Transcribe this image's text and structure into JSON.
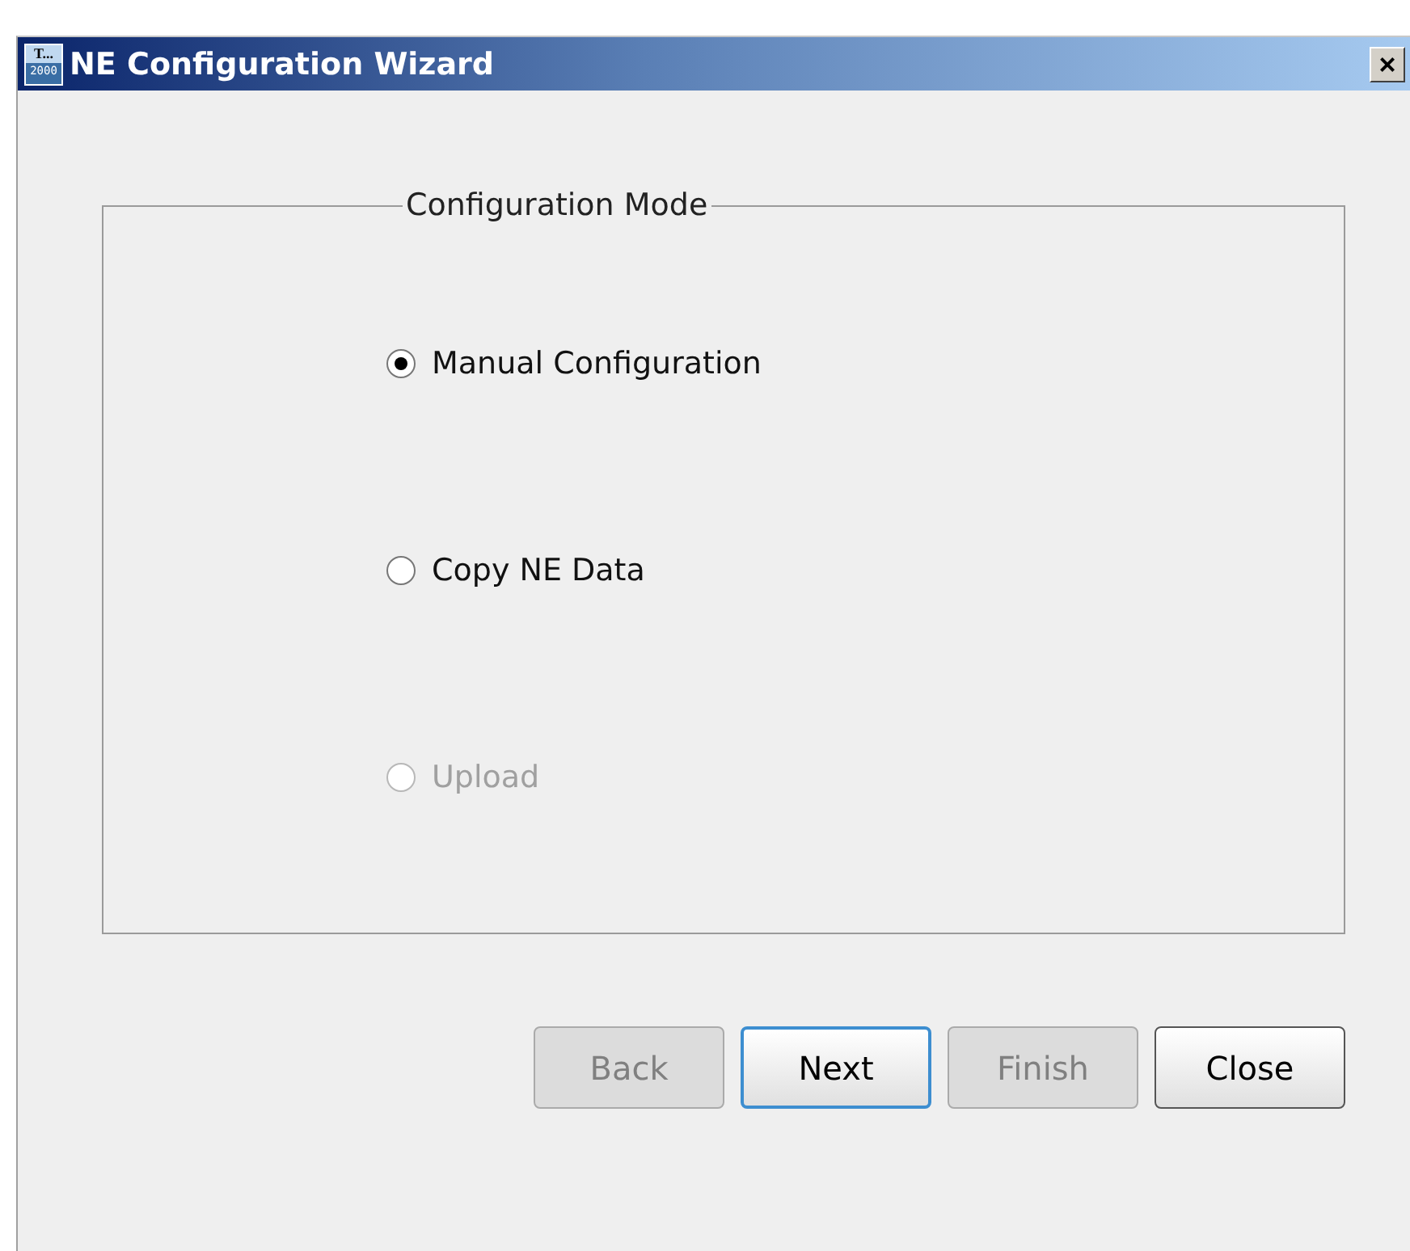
{
  "window": {
    "title": "NE Configuration Wizard",
    "icon_text": [
      "T...",
      "2000"
    ],
    "close_glyph": "×"
  },
  "group": {
    "title": "Configuration Mode",
    "options": [
      {
        "label": "Manual Configuration",
        "selected": true,
        "disabled": false
      },
      {
        "label": "Copy NE Data",
        "selected": false,
        "disabled": false
      },
      {
        "label": "Upload",
        "selected": false,
        "disabled": true
      }
    ]
  },
  "buttons": [
    {
      "label": "Back",
      "disabled": true,
      "focused": false
    },
    {
      "label": "Next",
      "disabled": false,
      "focused": true
    },
    {
      "label": "Finish",
      "disabled": true,
      "focused": false
    },
    {
      "label": "Close",
      "disabled": false,
      "focused": false
    }
  ]
}
